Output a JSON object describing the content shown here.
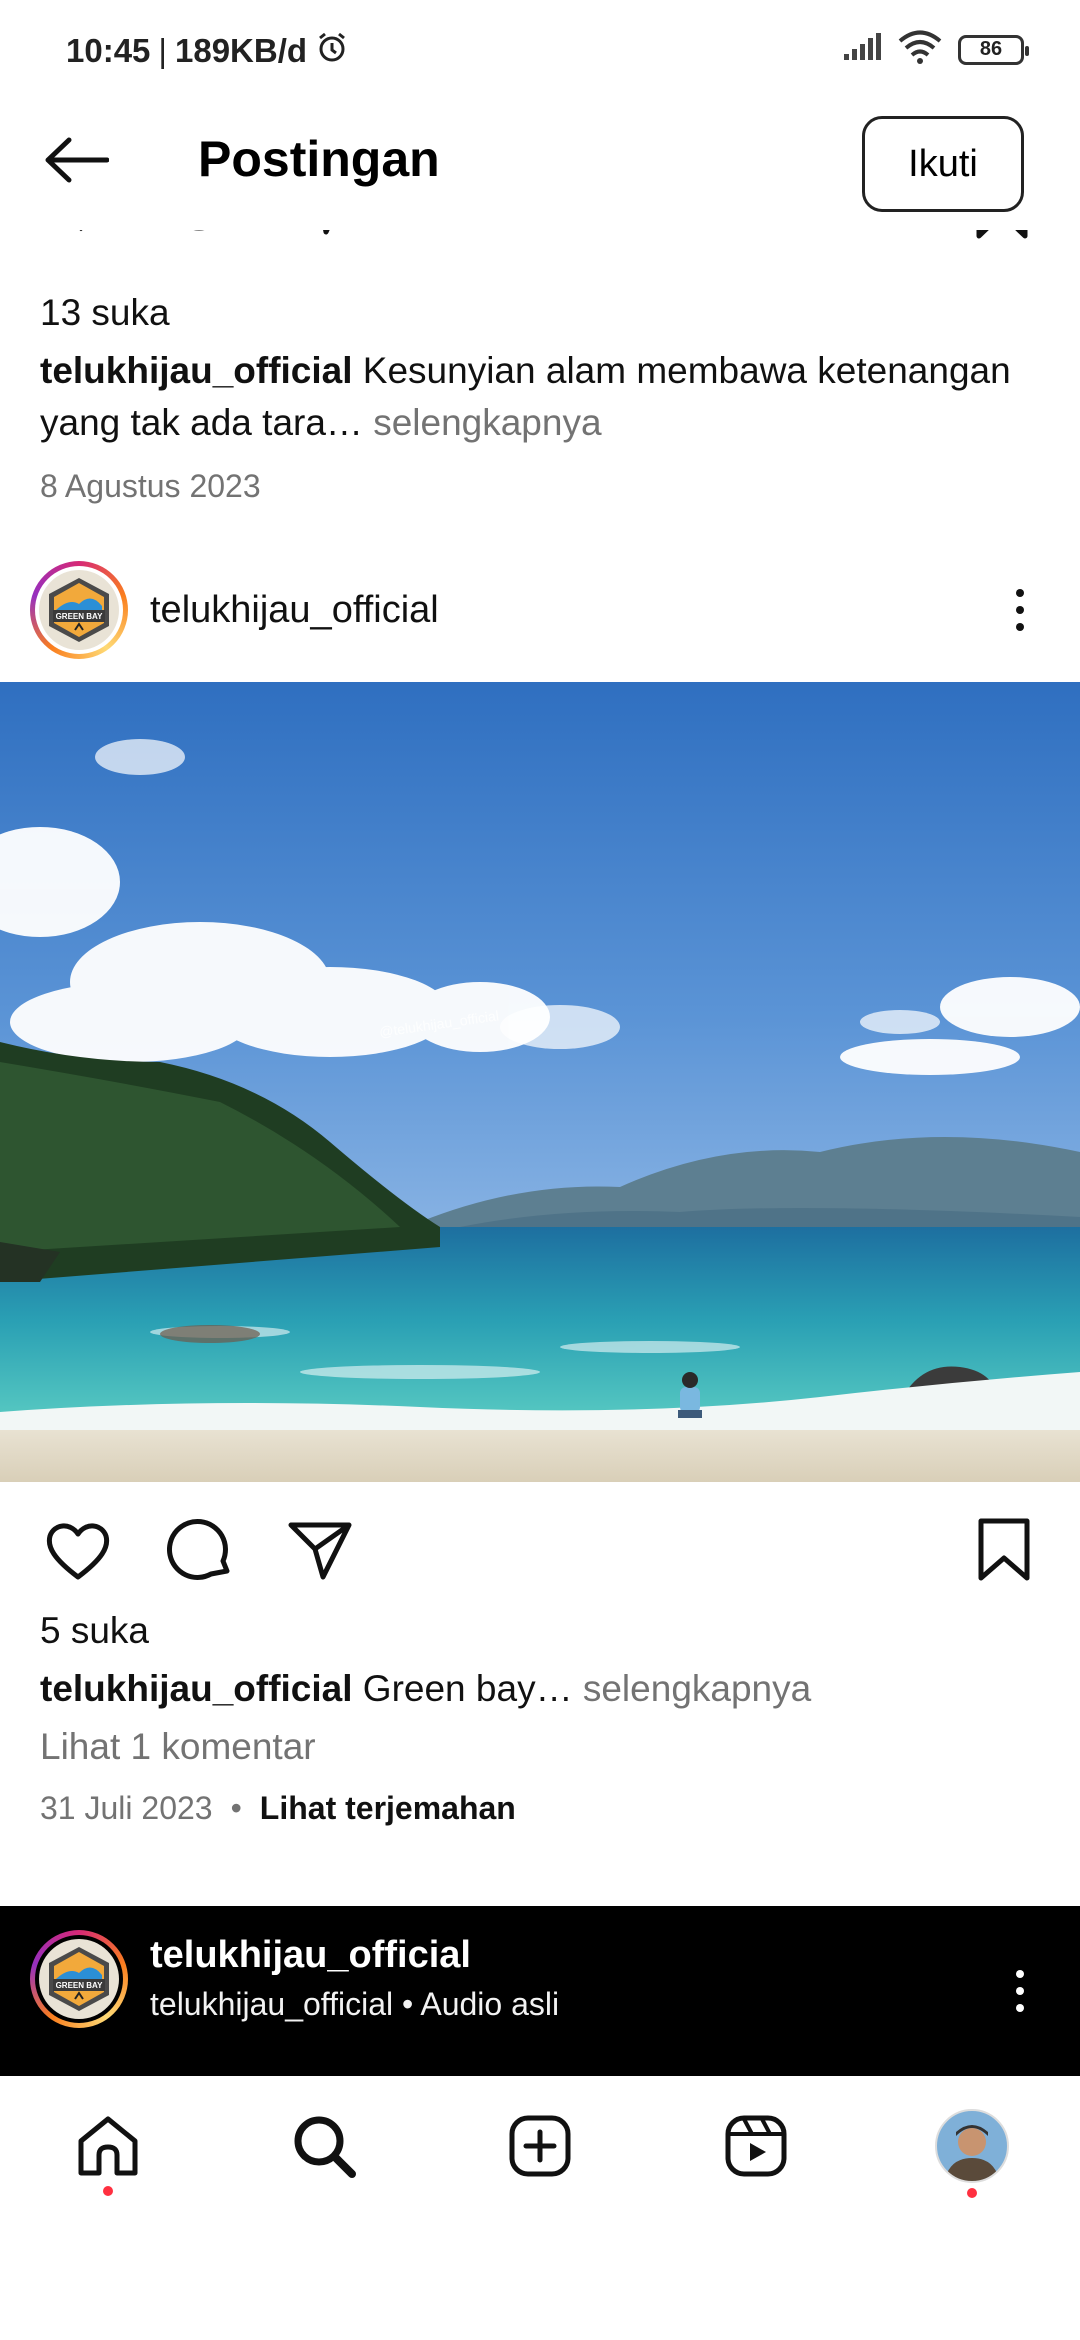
{
  "status_bar": {
    "time": "10:45",
    "separator": "|",
    "network_speed": "189KB/d",
    "battery": "86"
  },
  "header": {
    "title": "Postingan",
    "follow_label": "Ikuti"
  },
  "previous_post": {
    "likes": "13 suka",
    "username": "telukhijau_official",
    "caption": "Kesunyian alam membawa ketenangan yang tak ada tara",
    "ellipsis": "…",
    "more_label": "selengkapnya",
    "date": "8 Agustus 2023"
  },
  "post": {
    "username": "telukhijau_official",
    "avatar_text": "GREEN BAY",
    "photo_watermark": "@telukhijau_official",
    "likes": "5 suka",
    "caption_username": "telukhijau_official",
    "caption": "Green bay",
    "ellipsis": "…",
    "more_label": "selengkapnya",
    "view_comments": "Lihat 1 komentar",
    "date": "31 Juli 2023",
    "dot": "•",
    "translate_label": "Lihat terjemahan"
  },
  "reel": {
    "username": "telukhijau_official",
    "audio": "telukhijau_official • Audio asli"
  },
  "bottom_nav": {
    "items": [
      "home-icon",
      "search-icon",
      "create-icon",
      "reels-icon",
      "profile-avatar"
    ]
  },
  "colors": {
    "secondary_text": "#737373",
    "notification_dot": "#ff3040",
    "reel_bar": "#000000"
  }
}
